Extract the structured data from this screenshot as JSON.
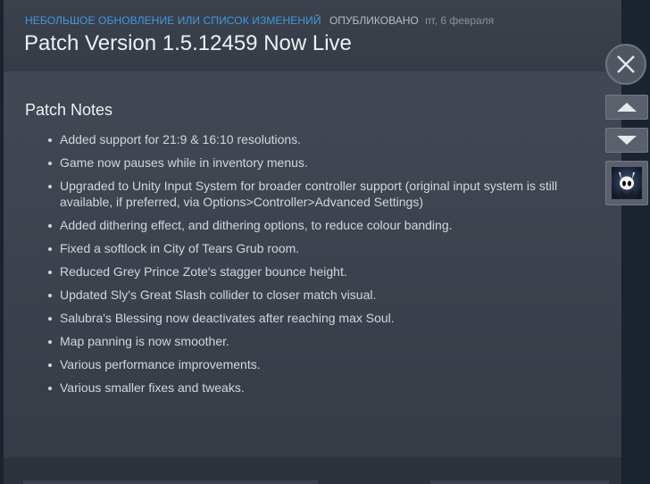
{
  "header": {
    "category": "НЕБОЛЬШОЕ ОБНОВЛЕНИЕ ИЛИ СПИСОК ИЗМЕНЕНИЙ",
    "published_label": "ОПУБЛИКОВАНО",
    "date": "пт, 6 февраля",
    "title": "Patch Version 1.5.12459 Now Live"
  },
  "notes": {
    "heading": "Patch Notes",
    "items": [
      "Added support for 21:9 & 16:10 resolutions.",
      "Game now pauses while in inventory menus.",
      "Upgraded to Unity Input System for broader controller support (original input system is still available, if preferred, via Options>Controller>Advanced Settings)",
      "Added dithering effect, and dithering options, to reduce colour banding.",
      "Fixed a softlock in City of Tears Grub room.",
      "Reduced Grey Prince Zote's stagger bounce height.",
      "Updated Sly's Great Slash collider to closer match visual.",
      "Salubra's Blessing now deactivates after reaching max Soul.",
      "Map panning is now smoother.",
      "Various performance improvements.",
      "Various smaller fixes and tweaks."
    ]
  },
  "controls": {
    "close_icon": "close-x-icon",
    "up_icon": "triangle-up-icon",
    "down_icon": "triangle-down-icon",
    "thumbnail_icon": "game-knight-icon"
  },
  "colors": {
    "category": "#3c9be3",
    "panel": "#3e4550",
    "background": "#1b2230"
  }
}
